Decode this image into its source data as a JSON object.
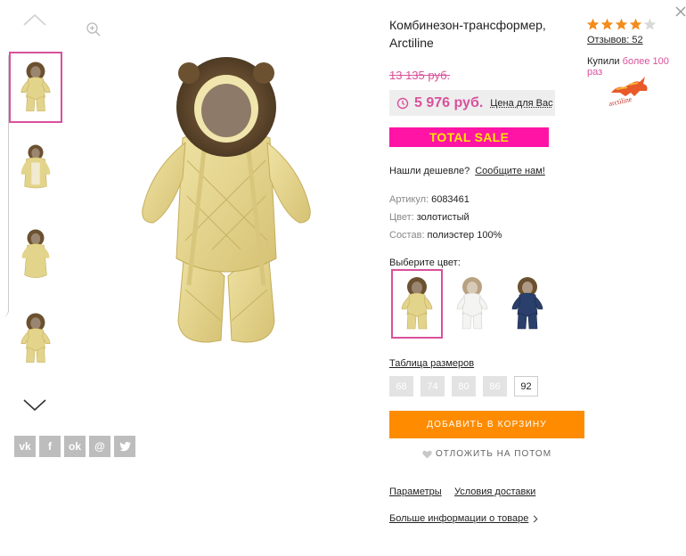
{
  "product": {
    "title": "Комбинезон-трансформер, Arctiline",
    "old_price": "13 135 руб.",
    "price": "5 976 руб.",
    "price_label": "Цена для Вас",
    "sale_badge": "TOTAL SALE",
    "cheaper_text": "Нашли дешевле?",
    "cheaper_link": "Сообщите нам!",
    "attributes": [
      {
        "key": "Артикул:",
        "value": "6083461"
      },
      {
        "key": "Цвет:",
        "value": "золотистый"
      },
      {
        "key": "Состав:",
        "value": "полиэстер 100%"
      }
    ],
    "choose_color_label": "Выберите цвет:",
    "colors": [
      {
        "name": "gold",
        "hex": "#e3d48c",
        "selected": true
      },
      {
        "name": "white",
        "hex": "#f1f1ee",
        "selected": false
      },
      {
        "name": "navy",
        "hex": "#2a3f6b",
        "selected": false
      }
    ],
    "size_table_label": "Таблица размеров",
    "sizes": [
      {
        "label": "68",
        "available": false
      },
      {
        "label": "74",
        "available": false
      },
      {
        "label": "80",
        "available": false
      },
      {
        "label": "86",
        "available": false
      },
      {
        "label": "92",
        "available": true
      }
    ],
    "add_to_cart": "ДОБАВИТЬ В КОРЗИНУ",
    "save_later": "ОТЛОЖИТЬ НА ПОТОМ",
    "links": {
      "params": "Параметры",
      "delivery": "Условия доставки",
      "more_info": "Больше информации о товаре"
    }
  },
  "rating": {
    "stars": 4,
    "max": 5,
    "reviews": "Отзывов: 52",
    "bought_prefix": "Купили",
    "bought_value": "более 100 раз"
  },
  "brand_logo_text": "arctiline",
  "gallery": {
    "thumbnails": 4,
    "selected_index": 0
  },
  "social": [
    "vk",
    "f",
    "ok",
    "@",
    "tw"
  ],
  "colors": {
    "accent_pink": "#d9519b",
    "sale_bg": "#ff14a5",
    "sale_text": "#ffe600",
    "cart_orange": "#ff8c00",
    "star_orange": "#f28c1b"
  }
}
